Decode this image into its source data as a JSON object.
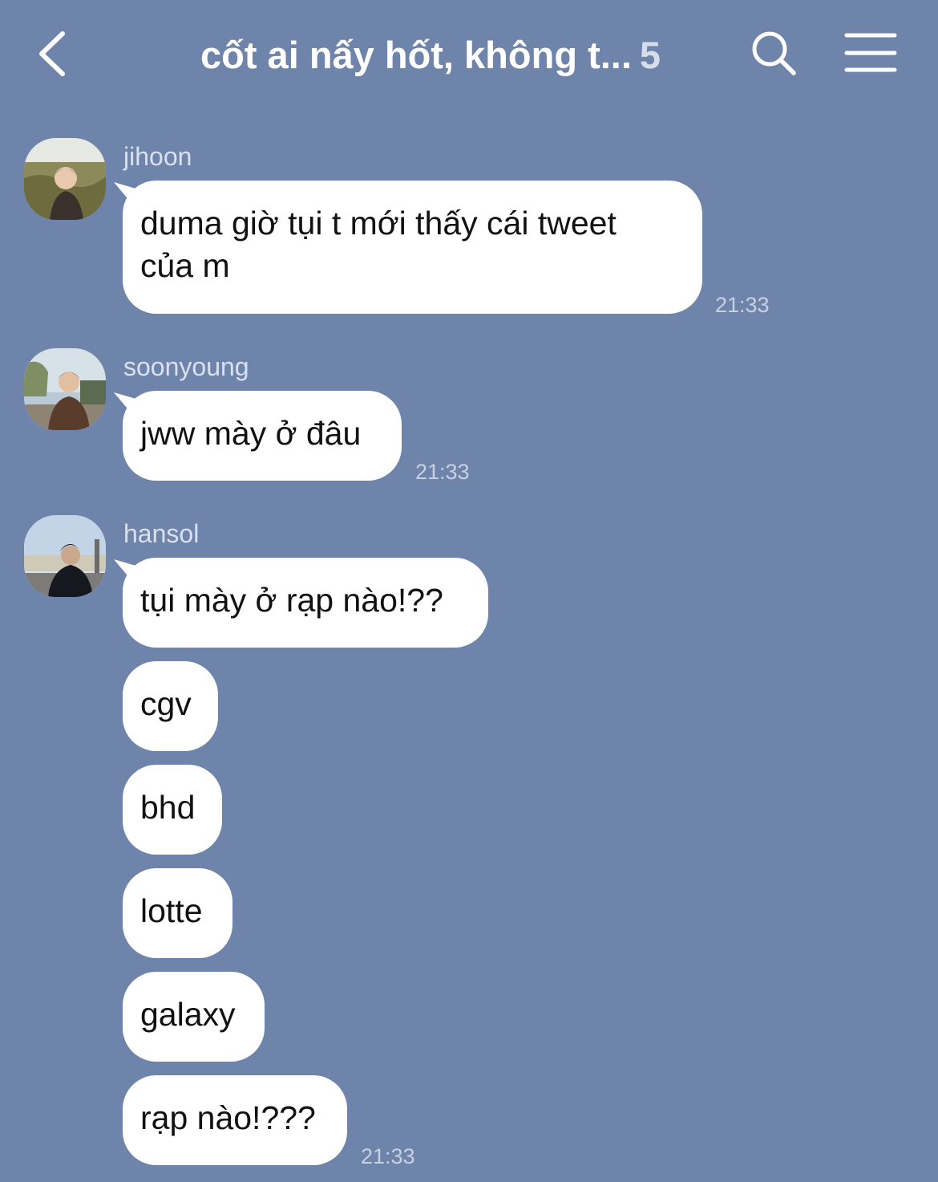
{
  "header": {
    "back_icon": "chevron-left-icon",
    "title": "cốt ai nấy hốt, không t...",
    "member_count": "5",
    "search_icon": "search-icon",
    "menu_icon": "hamburger-menu-icon"
  },
  "colors": {
    "background": "#6f84aa",
    "bubble": "#ffffff",
    "text_primary": "#111111",
    "header_text": "#ffffff",
    "meta_text": "#c7d1e2"
  },
  "messages": [
    {
      "sender": "jihoon",
      "avatar": "profile-photo",
      "bubbles": [
        {
          "line1": "duma giờ tụi t mới thấy cái tweet",
          "line2": "của m"
        }
      ],
      "time": "21:33"
    },
    {
      "sender": "soonyoung",
      "avatar": "profile-photo",
      "bubbles": [
        {
          "text": "jww mày ở đâu"
        }
      ],
      "time": "21:33"
    },
    {
      "sender": "hansol",
      "avatar": "profile-photo",
      "bubbles": [
        {
          "text": "tụi mày ở rạp nào!??"
        },
        {
          "text": "cgv"
        },
        {
          "text": "bhd"
        },
        {
          "text": "lotte"
        },
        {
          "text": "galaxy"
        },
        {
          "text": "rạp nào!???"
        }
      ],
      "time": "21:33"
    }
  ]
}
